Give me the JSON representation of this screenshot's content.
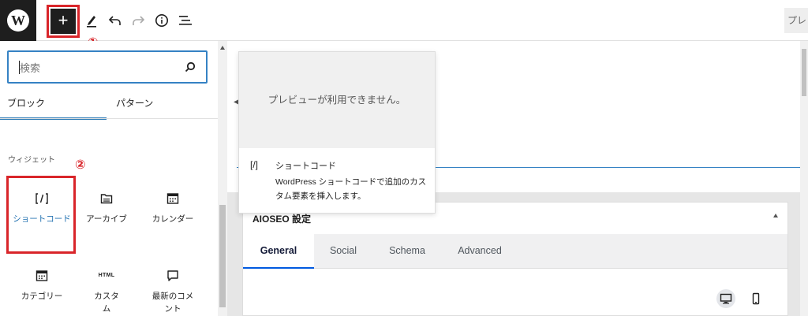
{
  "toolbar": {
    "logo_letter": "W",
    "add_block_label": "+",
    "preview_label": "プレビュー"
  },
  "annotations": {
    "one": "①",
    "two": "②"
  },
  "colors": {
    "accent": "#2271b1",
    "highlight": "#d9252a"
  },
  "inserter": {
    "search": {
      "placeholder": "検索",
      "value": ""
    },
    "tabs": [
      {
        "label": "ブロック"
      },
      {
        "label": "パターン"
      }
    ],
    "category": "ウィジェット",
    "blocks": [
      {
        "label": "ショートコード",
        "icon": "shortcode-icon"
      },
      {
        "label": "アーカイブ",
        "icon": "archive-icon"
      },
      {
        "label": "カレンダー",
        "icon": "calendar-icon"
      },
      {
        "label": "カテゴリー",
        "icon": "categories-icon"
      },
      {
        "label": "カスタムHTML",
        "icon_text": "HTML"
      },
      {
        "label": "最新のコメント",
        "icon": "comment-icon"
      }
    ]
  },
  "preview": {
    "unavailable": "プレビューが利用できません。",
    "icon": "[/]",
    "title": "ショートコード",
    "description": "WordPress ショートコードで追加のカスタム要素を挿入します。"
  },
  "aioseo": {
    "title": "AIOSEO 設定",
    "tabs": [
      {
        "label": "General"
      },
      {
        "label": "Social"
      },
      {
        "label": "Schema"
      },
      {
        "label": "Advanced"
      }
    ]
  }
}
